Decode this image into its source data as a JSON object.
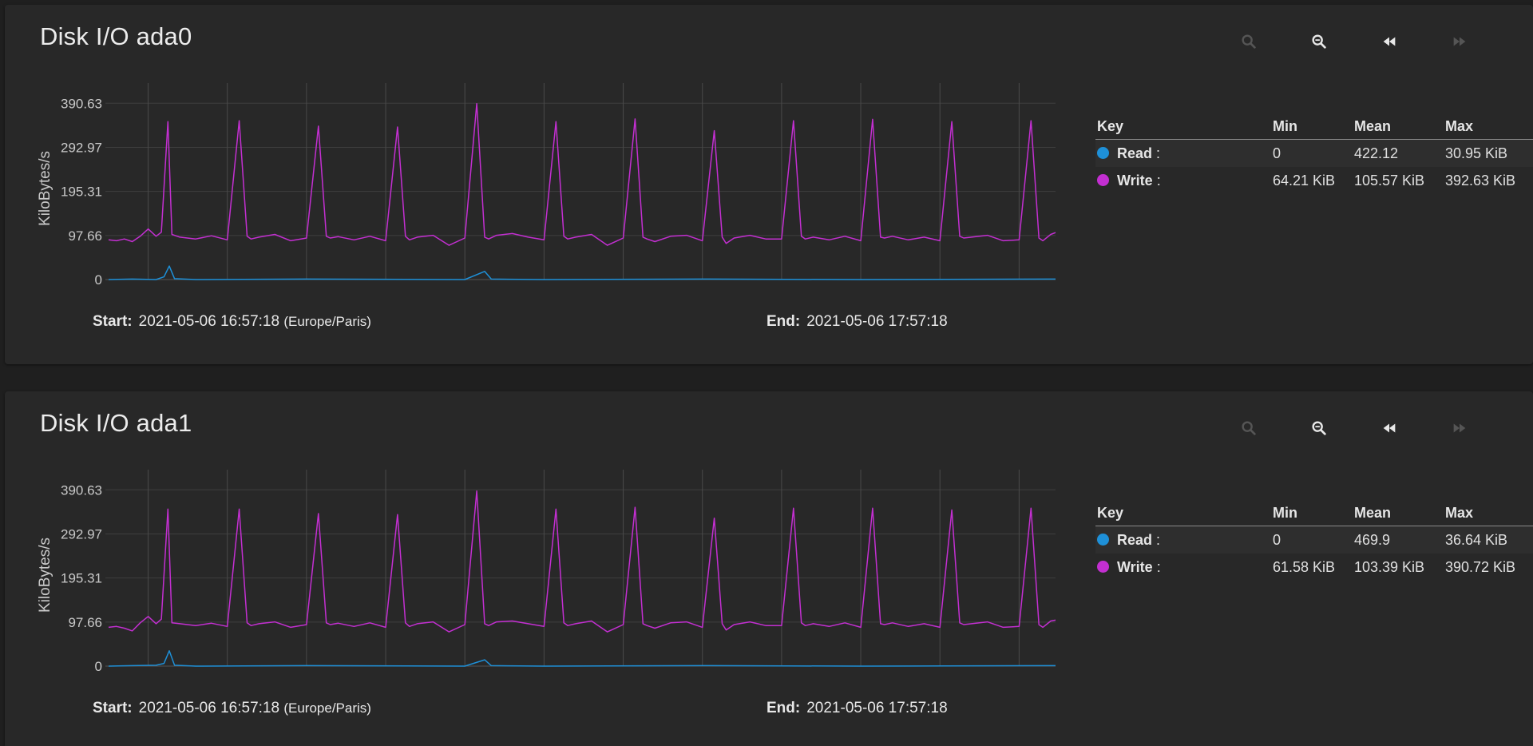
{
  "colors": {
    "read": "#1e90d8",
    "write": "#c32fd1",
    "background": "#1f1f1f",
    "card": "#282828",
    "grid": "#4a4a4a"
  },
  "toolbar": {
    "zoom_in_icon": "zoom-in-icon",
    "zoom_out_icon": "zoom-out-icon",
    "back_icon": "rewind-icon",
    "forward_icon": "fast-forward-icon"
  },
  "panels": [
    {
      "title": "Disk I/O ada0",
      "start_label": "Start:",
      "start_value": "2021-05-06 16:57:18",
      "timezone": "(Europe/Paris)",
      "end_label": "End:",
      "end_value": "2021-05-06 17:57:18",
      "legend": {
        "headers": {
          "key": "Key",
          "min": "Min",
          "mean": "Mean",
          "max": "Max"
        },
        "rows": [
          {
            "name": "Read",
            "suffix": " :",
            "min": "0",
            "mean": "422.12",
            "max": "30.95 KiB"
          },
          {
            "name": "Write",
            "suffix": " :",
            "min": "64.21 KiB",
            "mean": "105.57 KiB",
            "max": "392.63 KiB"
          }
        ]
      }
    },
    {
      "title": "Disk I/O ada1",
      "start_label": "Start:",
      "start_value": "2021-05-06 16:57:18",
      "timezone": "(Europe/Paris)",
      "end_label": "End:",
      "end_value": "2021-05-06 17:57:18",
      "legend": {
        "headers": {
          "key": "Key",
          "min": "Min",
          "mean": "Mean",
          "max": "Max"
        },
        "rows": [
          {
            "name": "Read",
            "suffix": " :",
            "min": "0",
            "mean": "469.9",
            "max": "36.64 KiB"
          },
          {
            "name": "Write",
            "suffix": " :",
            "min": "61.58 KiB",
            "mean": "103.39 KiB",
            "max": "390.72 KiB"
          }
        ]
      }
    }
  ],
  "chart_data": [
    {
      "type": "line",
      "ylabel": "KiloBytes/s",
      "y_ticks": [
        "390.63",
        "292.97",
        "195.31",
        "97.66",
        "0"
      ],
      "ylim": [
        0,
        400
      ],
      "x_ticks": [
        "17:00",
        "17:05",
        "17:10",
        "17:15",
        "17:20",
        "17:25",
        "17:30",
        "17:35",
        "17:40",
        "17:45",
        "17:50",
        "17:55"
      ],
      "xlim": [
        "16:57:18",
        "17:57:18"
      ],
      "grid": true,
      "series": [
        {
          "name": "Write",
          "x": [
            "16:57:30",
            "16:58:00",
            "16:58:30",
            "16:59:00",
            "16:59:30",
            "17:00:00",
            "17:00:30",
            "17:00:50",
            "17:01:15",
            "17:01:30",
            "17:02:00",
            "17:03:00",
            "17:04:00",
            "17:05:00",
            "17:05:45",
            "17:06:15",
            "17:06:30",
            "17:07:00",
            "17:08:00",
            "17:09:00",
            "17:10:00",
            "17:10:45",
            "17:11:15",
            "17:11:30",
            "17:12:00",
            "17:13:00",
            "17:14:00",
            "17:15:00",
            "17:15:45",
            "17:16:15",
            "17:16:30",
            "17:17:00",
            "17:18:00",
            "17:19:00",
            "17:20:00",
            "17:20:45",
            "17:21:15",
            "17:21:30",
            "17:22:00",
            "17:23:00",
            "17:24:00",
            "17:25:00",
            "17:25:45",
            "17:26:15",
            "17:26:30",
            "17:27:00",
            "17:28:00",
            "17:29:00",
            "17:30:00",
            "17:30:45",
            "17:31:15",
            "17:31:30",
            "17:32:00",
            "17:33:00",
            "17:34:00",
            "17:35:00",
            "17:35:45",
            "17:36:15",
            "17:36:30",
            "17:37:00",
            "17:38:00",
            "17:39:00",
            "17:40:00",
            "17:40:45",
            "17:41:15",
            "17:41:30",
            "17:42:00",
            "17:43:00",
            "17:44:00",
            "17:45:00",
            "17:45:45",
            "17:46:15",
            "17:46:30",
            "17:47:00",
            "17:48:00",
            "17:49:00",
            "17:50:00",
            "17:50:45",
            "17:51:15",
            "17:51:30",
            "17:52:00",
            "17:53:00",
            "17:54:00",
            "17:55:00",
            "17:55:45",
            "17:56:15",
            "17:56:30",
            "17:57:00",
            "17:57:18"
          ],
          "values": [
            88,
            86,
            90,
            84,
            96,
            112,
            96,
            105,
            350,
            100,
            94,
            90,
            97,
            88,
            352,
            96,
            90,
            94,
            100,
            86,
            92,
            340,
            96,
            92,
            95,
            88,
            96,
            86,
            338,
            96,
            88,
            94,
            98,
            76,
            92,
            390,
            94,
            90,
            98,
            102,
            94,
            88,
            350,
            96,
            90,
            94,
            100,
            76,
            92,
            356,
            94,
            90,
            84,
            96,
            98,
            86,
            330,
            94,
            80,
            92,
            98,
            90,
            90,
            352,
            96,
            90,
            94,
            88,
            96,
            86,
            355,
            94,
            92,
            96,
            88,
            94,
            86,
            350,
            96,
            92,
            94,
            98,
            86,
            88,
            352,
            92,
            86,
            100,
            104
          ]
        },
        {
          "name": "Read",
          "x": [
            "16:57:30",
            "16:59:00",
            "17:00:30",
            "17:01:00",
            "17:01:20",
            "17:01:40",
            "17:03:00",
            "17:10:00",
            "17:20:00",
            "17:21:15",
            "17:21:40",
            "17:25:00",
            "17:35:00",
            "17:45:00",
            "17:57:18"
          ],
          "values": [
            0,
            1,
            0,
            6,
            30,
            2,
            0,
            1,
            0,
            18,
            1,
            0,
            1,
            0,
            1
          ]
        }
      ]
    },
    {
      "type": "line",
      "ylabel": "KiloBytes/s",
      "y_ticks": [
        "390.63",
        "292.97",
        "195.31",
        "97.66",
        "0"
      ],
      "ylim": [
        0,
        400
      ],
      "x_ticks": [
        "17:00",
        "17:05",
        "17:10",
        "17:15",
        "17:20",
        "17:25",
        "17:30",
        "17:35",
        "17:40",
        "17:45",
        "17:50",
        "17:55"
      ],
      "xlim": [
        "16:57:18",
        "17:57:18"
      ],
      "grid": true,
      "series": [
        {
          "name": "Write",
          "x": [
            "16:57:30",
            "16:58:00",
            "16:58:30",
            "16:59:00",
            "16:59:30",
            "17:00:00",
            "17:00:30",
            "17:00:50",
            "17:01:15",
            "17:01:30",
            "17:02:00",
            "17:03:00",
            "17:04:00",
            "17:05:00",
            "17:05:45",
            "17:06:15",
            "17:06:30",
            "17:07:00",
            "17:08:00",
            "17:09:00",
            "17:10:00",
            "17:10:45",
            "17:11:15",
            "17:11:30",
            "17:12:00",
            "17:13:00",
            "17:14:00",
            "17:15:00",
            "17:15:45",
            "17:16:15",
            "17:16:30",
            "17:17:00",
            "17:18:00",
            "17:19:00",
            "17:20:00",
            "17:20:45",
            "17:21:15",
            "17:21:30",
            "17:22:00",
            "17:23:00",
            "17:24:00",
            "17:25:00",
            "17:25:45",
            "17:26:15",
            "17:26:30",
            "17:27:00",
            "17:28:00",
            "17:29:00",
            "17:30:00",
            "17:30:45",
            "17:31:15",
            "17:31:30",
            "17:32:00",
            "17:33:00",
            "17:34:00",
            "17:35:00",
            "17:35:45",
            "17:36:15",
            "17:36:30",
            "17:37:00",
            "17:38:00",
            "17:39:00",
            "17:40:00",
            "17:40:45",
            "17:41:15",
            "17:41:30",
            "17:42:00",
            "17:43:00",
            "17:44:00",
            "17:45:00",
            "17:45:45",
            "17:46:15",
            "17:46:30",
            "17:47:00",
            "17:48:00",
            "17:49:00",
            "17:50:00",
            "17:50:45",
            "17:51:15",
            "17:51:30",
            "17:52:00",
            "17:53:00",
            "17:54:00",
            "17:55:00",
            "17:55:45",
            "17:56:15",
            "17:56:30",
            "17:57:00",
            "17:57:18"
          ],
          "values": [
            86,
            88,
            84,
            78,
            96,
            110,
            94,
            104,
            348,
            96,
            94,
            90,
            95,
            88,
            348,
            96,
            90,
            94,
            98,
            86,
            92,
            338,
            96,
            92,
            95,
            88,
            96,
            86,
            336,
            96,
            88,
            94,
            98,
            76,
            92,
            388,
            94,
            90,
            98,
            100,
            94,
            88,
            348,
            96,
            90,
            94,
            100,
            76,
            92,
            352,
            94,
            90,
            84,
            96,
            98,
            86,
            328,
            94,
            80,
            92,
            98,
            90,
            90,
            350,
            96,
            90,
            94,
            88,
            96,
            86,
            350,
            94,
            92,
            96,
            88,
            94,
            86,
            346,
            96,
            92,
            94,
            98,
            86,
            88,
            350,
            92,
            86,
            100,
            102
          ]
        },
        {
          "name": "Read",
          "x": [
            "16:57:30",
            "16:59:00",
            "17:00:30",
            "17:01:00",
            "17:01:20",
            "17:01:40",
            "17:03:00",
            "17:10:00",
            "17:20:00",
            "17:21:15",
            "17:21:40",
            "17:25:00",
            "17:35:00",
            "17:45:00",
            "17:57:18"
          ],
          "values": [
            0,
            1,
            2,
            6,
            34,
            2,
            0,
            1,
            0,
            14,
            1,
            0,
            1,
            0,
            1
          ]
        }
      ]
    }
  ]
}
